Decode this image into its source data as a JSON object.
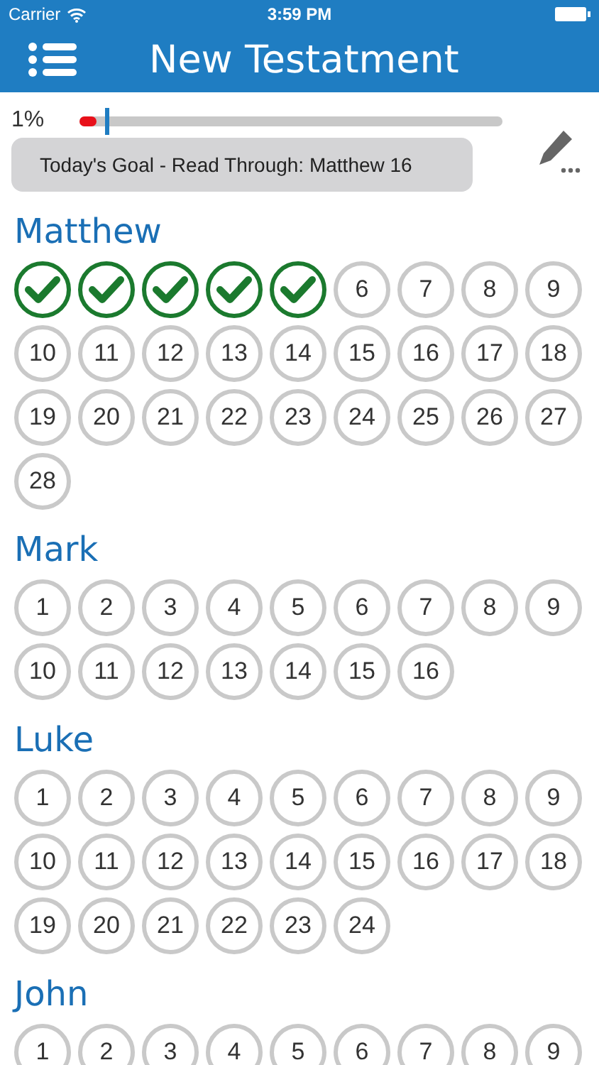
{
  "status_bar": {
    "carrier": "Carrier",
    "time": "3:59 PM"
  },
  "nav": {
    "title": "New Testatment"
  },
  "progress": {
    "percent": "1%",
    "level": 0.04
  },
  "goal": {
    "text": "Today's Goal - Read Through: Matthew 16"
  },
  "books": [
    {
      "name": "Matthew",
      "chapters": [
        {
          "read": true
        },
        {
          "read": true
        },
        {
          "read": true
        },
        {
          "read": true
        },
        {
          "read": true
        },
        {
          "label": "6",
          "read": false
        },
        {
          "label": "7",
          "read": false
        },
        {
          "label": "8",
          "read": false
        },
        {
          "label": "9",
          "read": false
        },
        {
          "label": "10",
          "read": false
        },
        {
          "label": "11",
          "read": false
        },
        {
          "label": "12",
          "read": false
        },
        {
          "label": "13",
          "read": false
        },
        {
          "label": "14",
          "read": false
        },
        {
          "label": "15",
          "read": false
        },
        {
          "label": "16",
          "read": false
        },
        {
          "label": "17",
          "read": false
        },
        {
          "label": "18",
          "read": false
        },
        {
          "label": "19",
          "read": false
        },
        {
          "label": "20",
          "read": false
        },
        {
          "label": "21",
          "read": false
        },
        {
          "label": "22",
          "read": false
        },
        {
          "label": "23",
          "read": false
        },
        {
          "label": "24",
          "read": false
        },
        {
          "label": "25",
          "read": false
        },
        {
          "label": "26",
          "read": false
        },
        {
          "label": "27",
          "read": false
        },
        {
          "label": "28",
          "read": false
        }
      ]
    },
    {
      "name": "Mark",
      "chapters": [
        {
          "label": "1",
          "read": false
        },
        {
          "label": "2",
          "read": false
        },
        {
          "label": "3",
          "read": false
        },
        {
          "label": "4",
          "read": false
        },
        {
          "label": "5",
          "read": false
        },
        {
          "label": "6",
          "read": false
        },
        {
          "label": "7",
          "read": false
        },
        {
          "label": "8",
          "read": false
        },
        {
          "label": "9",
          "read": false
        },
        {
          "label": "10",
          "read": false
        },
        {
          "label": "11",
          "read": false
        },
        {
          "label": "12",
          "read": false
        },
        {
          "label": "13",
          "read": false
        },
        {
          "label": "14",
          "read": false
        },
        {
          "label": "15",
          "read": false
        },
        {
          "label": "16",
          "read": false
        }
      ]
    },
    {
      "name": "Luke",
      "chapters": [
        {
          "label": "1",
          "read": false
        },
        {
          "label": "2",
          "read": false
        },
        {
          "label": "3",
          "read": false
        },
        {
          "label": "4",
          "read": false
        },
        {
          "label": "5",
          "read": false
        },
        {
          "label": "6",
          "read": false
        },
        {
          "label": "7",
          "read": false
        },
        {
          "label": "8",
          "read": false
        },
        {
          "label": "9",
          "read": false
        },
        {
          "label": "10",
          "read": false
        },
        {
          "label": "11",
          "read": false
        },
        {
          "label": "12",
          "read": false
        },
        {
          "label": "13",
          "read": false
        },
        {
          "label": "14",
          "read": false
        },
        {
          "label": "15",
          "read": false
        },
        {
          "label": "16",
          "read": false
        },
        {
          "label": "17",
          "read": false
        },
        {
          "label": "18",
          "read": false
        },
        {
          "label": "19",
          "read": false
        },
        {
          "label": "20",
          "read": false
        },
        {
          "label": "21",
          "read": false
        },
        {
          "label": "22",
          "read": false
        },
        {
          "label": "23",
          "read": false
        },
        {
          "label": "24",
          "read": false
        }
      ]
    },
    {
      "name": "John",
      "chapters": [
        {
          "label": "1",
          "read": false
        },
        {
          "label": "2",
          "read": false
        },
        {
          "label": "3",
          "read": false
        },
        {
          "label": "4",
          "read": false
        },
        {
          "label": "5",
          "read": false
        },
        {
          "label": "6",
          "read": false
        },
        {
          "label": "7",
          "read": false
        },
        {
          "label": "8",
          "read": false
        },
        {
          "label": "9",
          "read": false
        }
      ]
    }
  ]
}
